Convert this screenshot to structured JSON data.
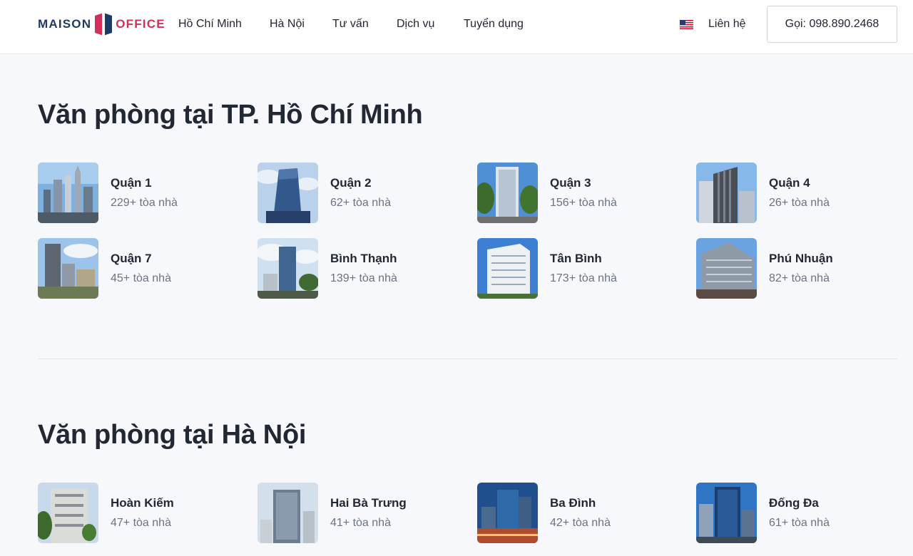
{
  "header": {
    "logo": {
      "word1": "MAISON",
      "word2": "OFFICE"
    },
    "nav": [
      "Hồ Chí Minh",
      "Hà Nội",
      "Tư vấn",
      "Dịch vụ",
      "Tuyển dụng"
    ],
    "flag_icon": "us-flag-icon",
    "contact_label": "Liên hệ",
    "call_label": "Gọi: 098.890.2468"
  },
  "sections": [
    {
      "title": "Văn phòng tại TP. Hồ Chí Minh",
      "districts": [
        {
          "name": "Quận 1",
          "count": "229+ tòa nhà"
        },
        {
          "name": "Quận 2",
          "count": "62+ tòa nhà"
        },
        {
          "name": "Quận 3",
          "count": "156+ tòa nhà"
        },
        {
          "name": "Quận 4",
          "count": "26+ tòa nhà"
        },
        {
          "name": "Quận 7",
          "count": "45+ tòa nhà"
        },
        {
          "name": "Bình Thạnh",
          "count": "139+ tòa nhà"
        },
        {
          "name": "Tân Bình",
          "count": "173+ tòa nhà"
        },
        {
          "name": "Phú Nhuận",
          "count": "82+ tòa nhà"
        }
      ]
    },
    {
      "title": "Văn phòng tại Hà Nội",
      "districts": [
        {
          "name": "Hoàn Kiếm",
          "count": "47+ tòa nhà"
        },
        {
          "name": "Hai Bà Trưng",
          "count": "41+ tòa nhà"
        },
        {
          "name": "Ba Đình",
          "count": "42+ tòa nhà"
        },
        {
          "name": "Đống Đa",
          "count": "61+ tòa nhà"
        }
      ]
    }
  ],
  "colors": {
    "brand_navy": "#1d3b63",
    "brand_pink": "#d32f5b",
    "page_bg": "#f7f8fc",
    "muted_text": "#6b7280"
  }
}
